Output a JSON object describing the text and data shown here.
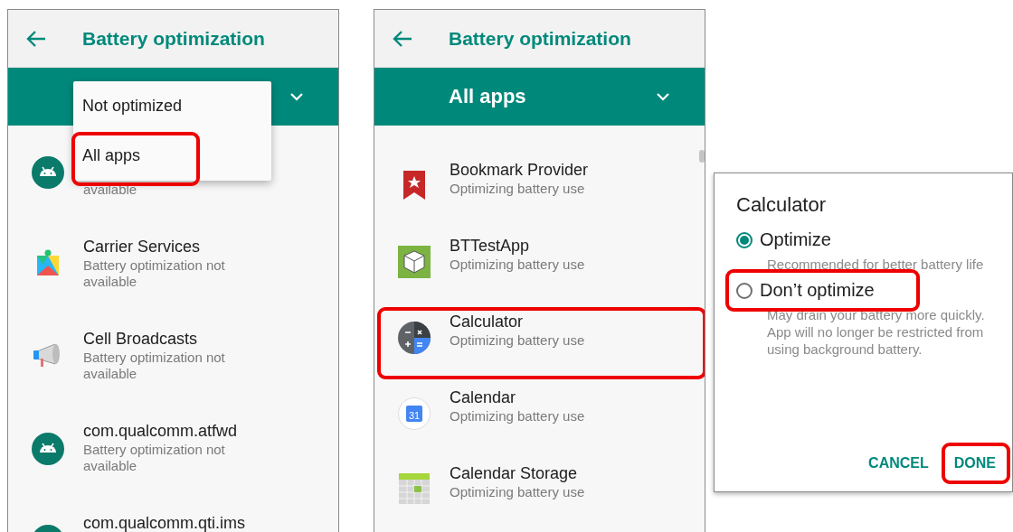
{
  "screens": [
    {
      "title": "Battery optimization",
      "menu": [
        {
          "label": "Not optimized",
          "highlighted": false
        },
        {
          "label": "All apps",
          "highlighted": true
        }
      ],
      "apps": [
        {
          "kind": "android",
          "subtitle": "available",
          "highlighted": false
        },
        {
          "kind": "puzzle",
          "title": "Carrier Services",
          "subtitle": "Battery optimization not available",
          "highlighted": false
        },
        {
          "kind": "megaphone",
          "title": "Cell Broadcasts",
          "subtitle": "Battery optimization not available",
          "highlighted": false
        },
        {
          "kind": "android",
          "title": "com.qualcomm.atfwd",
          "subtitle": "Battery optimization not available",
          "highlighted": false
        },
        {
          "kind": "android",
          "title": "com.qualcomm.qti.ims",
          "highlighted": false
        }
      ]
    },
    {
      "title": "Battery optimization",
      "filter": "All apps",
      "apps": [
        {
          "kind": "bookmark",
          "title": "Bookmark Provider",
          "subtitle": "Optimizing battery use",
          "highlighted": false
        },
        {
          "kind": "cube",
          "title": "BTTestApp",
          "subtitle": "Optimizing battery use",
          "highlighted": false
        },
        {
          "kind": "calculator",
          "title": "Calculator",
          "subtitle": "Optimizing battery use",
          "highlighted": true
        },
        {
          "kind": "calendar",
          "date": "31",
          "title": "Calendar",
          "subtitle": "Optimizing battery use",
          "highlighted": false
        },
        {
          "kind": "grid",
          "title": "Calendar Storage",
          "subtitle": "Optimizing battery use",
          "highlighted": false
        }
      ]
    }
  ],
  "dialog": {
    "title": "Calculator",
    "options": [
      {
        "label": "Optimize",
        "description": "Recommended for better battery life",
        "selected": true,
        "highlighted": false
      },
      {
        "label": "Don’t optimize",
        "description": "May drain your battery more quickly. App will no longer be restricted from using background battery.",
        "selected": false,
        "highlighted": true
      }
    ],
    "buttons": [
      {
        "label": "CANCEL",
        "highlighted": false
      },
      {
        "label": "DONE",
        "highlighted": true
      }
    ]
  }
}
